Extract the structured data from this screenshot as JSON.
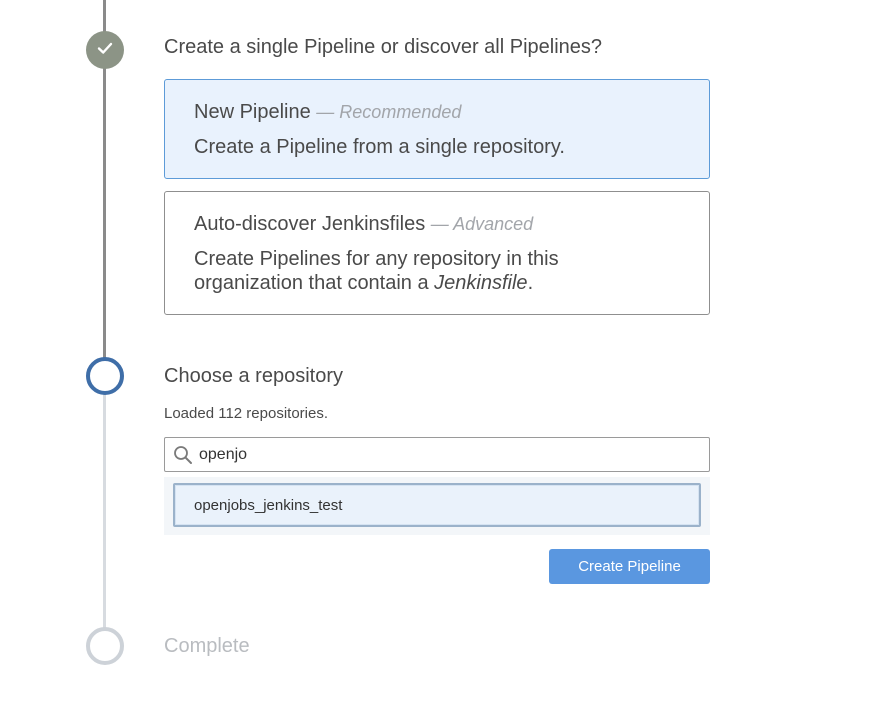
{
  "steps": {
    "choose_type": {
      "title": "Create a single Pipeline or discover all Pipelines?",
      "options": [
        {
          "title": "New Pipeline",
          "tag": "— Recommended",
          "description": "Create a Pipeline from a single repository."
        },
        {
          "title": "Auto-discover Jenkinsfiles",
          "tag": "— Advanced",
          "description_line1": "Create Pipelines for any repository in this",
          "description_line2_prefix": "organization that contain a ",
          "description_line2_em": "Jenkinsfile",
          "description_line2_suffix": "."
        }
      ]
    },
    "choose_repo": {
      "title": "Choose a repository",
      "status": "Loaded 112 repositories.",
      "search_value": "openjo",
      "results": [
        "openjobs_jenkins_test"
      ],
      "button_label": "Create Pipeline"
    },
    "complete": {
      "title": "Complete"
    }
  },
  "icons": {
    "step_complete": "check-icon",
    "search": "search-icon"
  },
  "colors": {
    "accent": "#5a97e0",
    "active_step": "#3f6ea8",
    "completed_step": "#8c9486",
    "pending_step": "#cdd2d8",
    "selected_card_bg": "#e9f2fd"
  }
}
